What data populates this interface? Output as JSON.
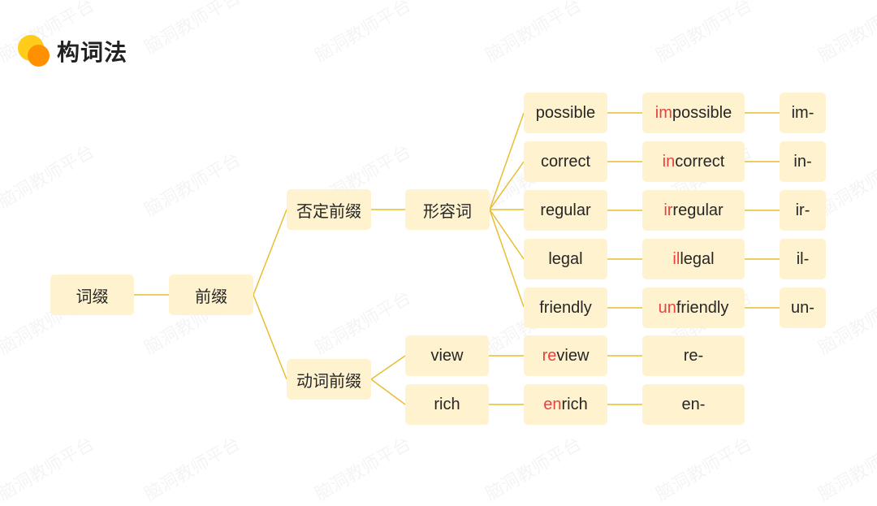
{
  "header": {
    "title": "构词法",
    "logo_icon": "two-circles-logo-icon"
  },
  "watermark": "脑洞教师平台",
  "colors": {
    "node_bg": "#FFF3CF",
    "edge": "#E9BE2F",
    "highlight": "#E8413E",
    "logo_yellow": "#FFCC1A",
    "logo_orange": "#FF9100"
  },
  "tree": {
    "root": "词缀",
    "level1": "前缀",
    "negative": {
      "label": "否定前缀",
      "pos": "形容词",
      "rows": [
        {
          "base": "possible",
          "prefix_part": "im",
          "rest": "possible",
          "prefix": "im-"
        },
        {
          "base": "correct",
          "prefix_part": "in",
          "rest": "correct",
          "prefix": "in-"
        },
        {
          "base": "regular",
          "prefix_part": "ir",
          "rest": "regular",
          "prefix": "ir-"
        },
        {
          "base": "legal",
          "prefix_part": "il",
          "rest": "legal",
          "prefix": "il-"
        },
        {
          "base": "friendly",
          "prefix_part": "un",
          "rest": "friendly",
          "prefix": "un-"
        }
      ]
    },
    "verb": {
      "label": "动词前缀",
      "rows": [
        {
          "base": "view",
          "prefix_part": "re",
          "rest": "view",
          "prefix": "re-"
        },
        {
          "base": "rich",
          "prefix_part": "en",
          "rest": "rich",
          "prefix": "en-"
        }
      ]
    }
  }
}
